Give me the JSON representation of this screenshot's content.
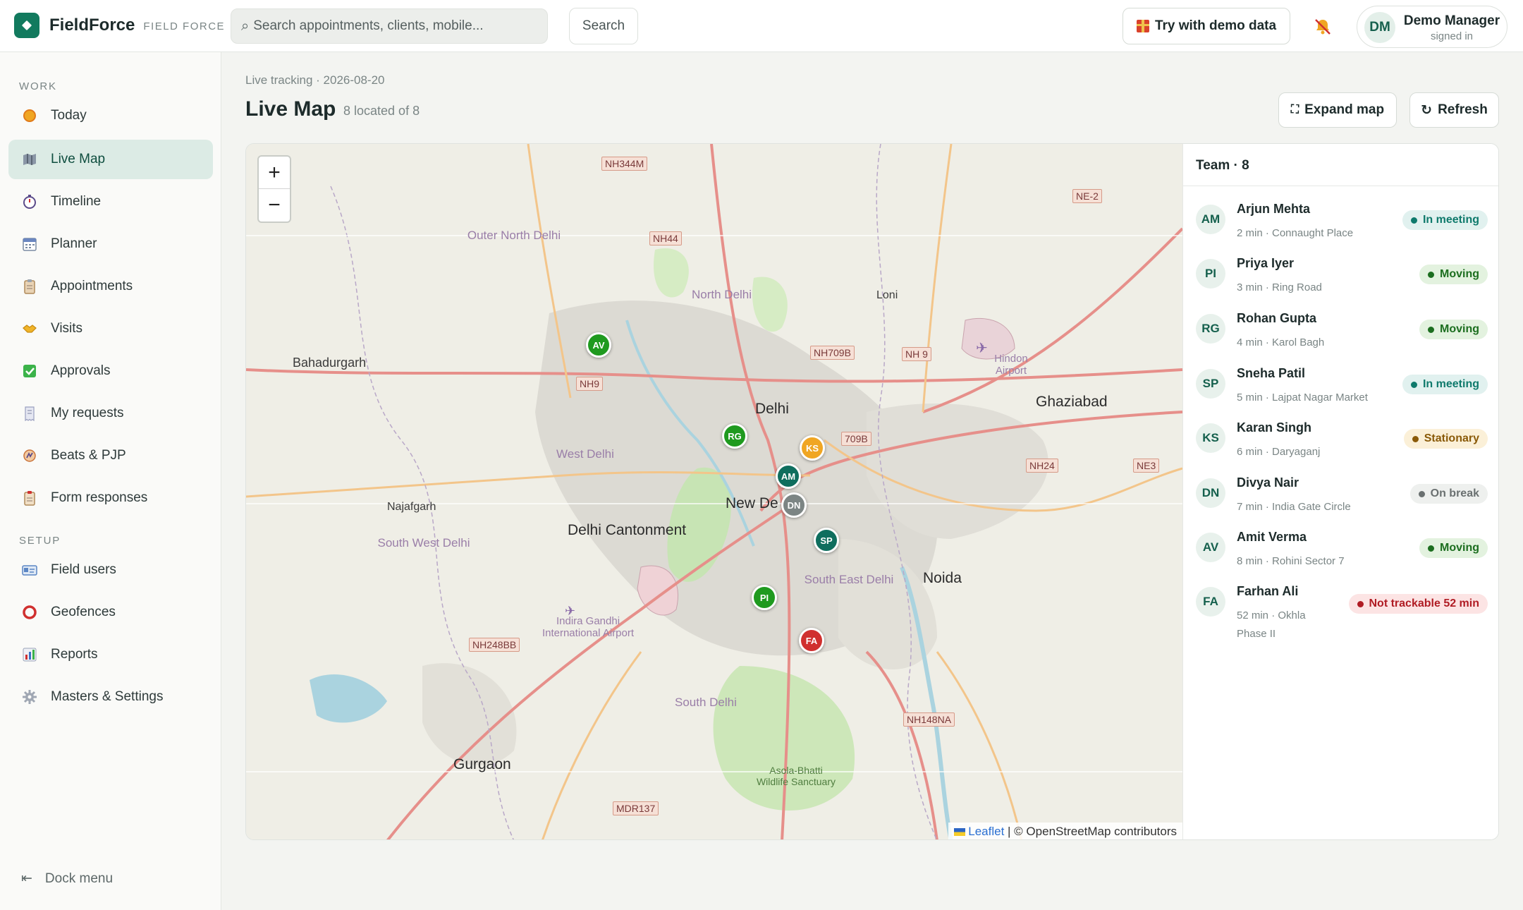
{
  "brand": {
    "name": "FieldForce",
    "subtitle": "FIELD FORCE"
  },
  "search": {
    "placeholder": "Search appointments, clients, mobile...",
    "button": "Search"
  },
  "header": {
    "demo_label": "Try with demo data",
    "user_initials": "DM",
    "user_name": "Demo Manager",
    "user_status": "signed in"
  },
  "sidebar": {
    "work_label": "WORK",
    "setup_label": "SETUP",
    "work_items": [
      {
        "label": "Today",
        "icon": "sun-icon"
      },
      {
        "label": "Live Map",
        "icon": "map-icon",
        "active": true
      },
      {
        "label": "Timeline",
        "icon": "stopwatch-icon"
      },
      {
        "label": "Planner",
        "icon": "calendar-icon"
      },
      {
        "label": "Appointments",
        "icon": "clipboard-icon"
      },
      {
        "label": "Visits",
        "icon": "handshake-icon"
      },
      {
        "label": "Approvals",
        "icon": "check-icon"
      },
      {
        "label": "My requests",
        "icon": "receipt-icon"
      },
      {
        "label": "Beats & PJP",
        "icon": "route-icon"
      },
      {
        "label": "Form responses",
        "icon": "form-icon"
      }
    ],
    "setup_items": [
      {
        "label": "Field users",
        "icon": "id-card-icon"
      },
      {
        "label": "Geofences",
        "icon": "ring-icon"
      },
      {
        "label": "Reports",
        "icon": "bar-chart-icon"
      },
      {
        "label": "Masters & Settings",
        "icon": "gear-icon"
      }
    ],
    "dock_label": "Dock menu"
  },
  "page": {
    "breadcrumb": "Live tracking · 2026-08-20",
    "title": "Live Map",
    "subtitle": "8 located of 8",
    "expand_label": "Expand map",
    "refresh_label": "Refresh"
  },
  "map": {
    "attribution_leaflet": "Leaflet",
    "attribution_rest": "| © OpenStreetMap contributors",
    "labels": [
      "Bahadurgarh",
      "Delhi",
      "New De",
      "Delhi Cantonment",
      "Noida",
      "Ghaziabad",
      "Gurgaon",
      "West Delhi",
      "South West Delhi",
      "South East Delhi",
      "South Delhi",
      "Outer North Delhi",
      "North Delhi",
      "Najafgarh",
      "Loni",
      "Hindon Airport",
      "Indira Gandhi International Airport",
      "Asola-Bhatti Wildlife Sanctuary"
    ],
    "road_shields": [
      "NH344M",
      "NH44",
      "NH9",
      "NH709B",
      "NH 9",
      "709B",
      "NH24",
      "NE3",
      "NE-2",
      "NH248BB",
      "NH148NA",
      "MDR137"
    ]
  },
  "team": {
    "title": "Team · 8",
    "members": [
      {
        "initials": "AM",
        "name": "Arjun Mehta",
        "meta": "2 min · Connaught Place",
        "status": "In meeting",
        "status_color": "#0f7a6c",
        "status_bg": "#e1f1ef",
        "marker_color": "#0f6e5e"
      },
      {
        "initials": "PI",
        "name": "Priya Iyer",
        "meta": "3 min · Ring Road",
        "status": "Moving",
        "status_color": "#1c6e1f",
        "status_bg": "#e3f2df",
        "marker_color": "#1f9a1f"
      },
      {
        "initials": "RG",
        "name": "Rohan Gupta",
        "meta": "4 min · Karol Bagh",
        "status": "Moving",
        "status_color": "#1c6e1f",
        "status_bg": "#e3f2df",
        "marker_color": "#1f9a1f"
      },
      {
        "initials": "SP",
        "name": "Sneha Patil",
        "meta": "5 min · Lajpat Nagar Market",
        "status": "In meeting",
        "status_color": "#0f7a6c",
        "status_bg": "#e1f1ef",
        "marker_color": "#0f6e5e"
      },
      {
        "initials": "KS",
        "name": "Karan Singh",
        "meta": "6 min · Daryaganj",
        "status": "Stationary",
        "status_color": "#8a5a08",
        "status_bg": "#fbf0d8",
        "marker_color": "#f0a623"
      },
      {
        "initials": "DN",
        "name": "Divya Nair",
        "meta": "7 min · India Gate Circle",
        "status": "On break",
        "status_color": "#6a7070",
        "status_bg": "#eef0ee",
        "marker_color": "#7c8584"
      },
      {
        "initials": "AV",
        "name": "Amit Verma",
        "meta": "8 min · Rohini Sector 7",
        "status": "Moving",
        "status_color": "#1c6e1f",
        "status_bg": "#e3f2df",
        "marker_color": "#1f9a1f"
      },
      {
        "initials": "FA",
        "name": "Farhan Ali",
        "meta_line1": "52 min · Okhla",
        "meta_line2": "Phase II",
        "status": "Not trackable 52 min",
        "status_color": "#b01c24",
        "status_bg": "#fce4e4",
        "marker_color": "#d0302f"
      }
    ]
  }
}
